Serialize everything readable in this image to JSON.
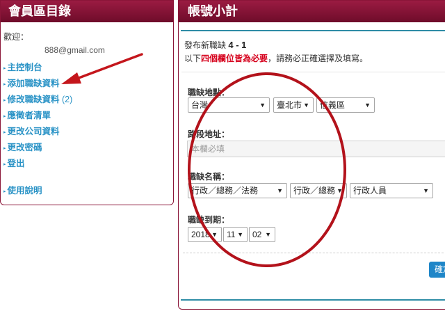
{
  "sidebar": {
    "title": "會員區目錄",
    "welcome": "歡迎：",
    "email": "888@gmail.com",
    "items": [
      {
        "label": "主控制台"
      },
      {
        "label": "添加職缺資料"
      },
      {
        "label": "修改職缺資料",
        "count": "(2)"
      },
      {
        "label": "應徵者清單"
      },
      {
        "label": "更改公司資料"
      },
      {
        "label": "更改密碼"
      },
      {
        "label": "登出"
      }
    ],
    "help": "使用說明"
  },
  "main": {
    "title": "帳號小計",
    "form_title": "發布新職缺",
    "step": "4 - 1",
    "notice_prefix": "以下",
    "notice_highlight": "四個欄位皆為必要",
    "notice_suffix": "，請務必正確選擇及填寫。",
    "location": {
      "label": "職缺地點：",
      "country": "台灣",
      "city": "臺北市",
      "district": "信義區"
    },
    "address": {
      "label": "路段地址：",
      "placeholder": "本欄必填"
    },
    "job_name": {
      "label": "職缺名稱：",
      "category": "行政／總務／法務",
      "subcategory": "行政／總務",
      "position": "行政人員"
    },
    "expiry": {
      "label": "職缺到期：",
      "year": "2018",
      "month": "11",
      "day": "02"
    },
    "confirm_label": "確定"
  },
  "colors": {
    "header_red": "#8a1538",
    "link_blue": "#2a93c6",
    "required_red": "#d6001c",
    "annotation_red": "#c4161c",
    "button_blue": "#1f86c8",
    "rule_teal": "#2e8ca6"
  }
}
